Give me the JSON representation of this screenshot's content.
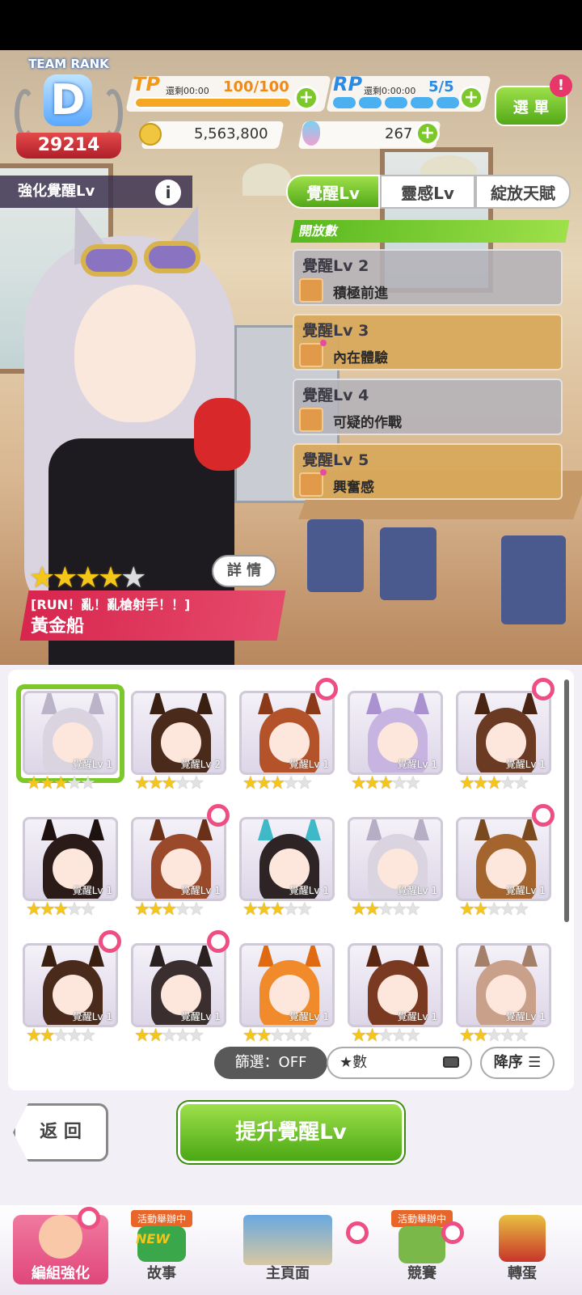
{
  "header": {
    "team_rank_label": "TEAM RANK",
    "rank_letter": "D",
    "rank_score": "29214",
    "tp": {
      "label": "TP",
      "remain": "還剩00:00",
      "value": "100/100",
      "fill": 1.0
    },
    "rp": {
      "label": "RP",
      "remain": "還剩0:00:00",
      "value": "5/5",
      "segments": 5
    },
    "money": "5,563,800",
    "carats": "267",
    "menu_label": "選 單",
    "menu_badge": "!"
  },
  "section": {
    "label": "強化覺醒Lv",
    "info": "i"
  },
  "tabs": [
    {
      "label": "覺醒Lv",
      "active": true
    },
    {
      "label": "靈感Lv",
      "active": false
    },
    {
      "label": "綻放天賦",
      "active": false
    }
  ],
  "open_label": "開放數",
  "levels": [
    {
      "title": "覺醒Lv 2",
      "skill": "積極前進",
      "style": "grey"
    },
    {
      "title": "覺醒Lv 3",
      "skill": "內在體驗",
      "style": "gold"
    },
    {
      "title": "覺醒Lv 4",
      "skill": "可疑的作戰",
      "style": "grey"
    },
    {
      "title": "覺醒Lv 5",
      "skill": "興奮感",
      "style": "gold"
    }
  ],
  "card": {
    "rarity": 4,
    "max_rarity": 5,
    "title": "[RUN！亂！亂槍射手！！]",
    "name": "黃金船",
    "detail_label": "詳 情"
  },
  "roster": [
    {
      "lv": "覺醒Lv 1",
      "stars": 3,
      "hair": "#d9d4e0",
      "ear": "#bbb3c8",
      "selected": true,
      "ring": false
    },
    {
      "lv": "覺醒Lv 2",
      "stars": 3,
      "hair": "#4a2a1a",
      "ear": "#3a2010",
      "selected": false,
      "ring": false
    },
    {
      "lv": "覺醒Lv 1",
      "stars": 3,
      "hair": "#b4532a",
      "ear": "#8a3a18",
      "selected": false,
      "ring": true
    },
    {
      "lv": "覺醒Lv 1",
      "stars": 3,
      "hair": "#c7b4e0",
      "ear": "#a992cf",
      "selected": false,
      "ring": false
    },
    {
      "lv": "覺醒Lv 1",
      "stars": 3,
      "hair": "#6a3a22",
      "ear": "#4a2412",
      "selected": false,
      "ring": true
    },
    {
      "lv": "覺醒Lv 1",
      "stars": 3,
      "hair": "#2a1a18",
      "ear": "#1e1210",
      "selected": false,
      "ring": false
    },
    {
      "lv": "覺醒Lv 1",
      "stars": 3,
      "hair": "#9a4a2a",
      "ear": "#6a3018",
      "selected": false,
      "ring": true
    },
    {
      "lv": "覺醒Lv 1",
      "stars": 3,
      "hair": "#2e2426",
      "ear": "#3fb8c8",
      "selected": false,
      "ring": false
    },
    {
      "lv": "覺醒Lv 1",
      "stars": 2,
      "hair": "#d9d4e0",
      "ear": "#b6aec4",
      "selected": false,
      "ring": false
    },
    {
      "lv": "覺醒Lv 1",
      "stars": 2,
      "hair": "#a4642e",
      "ear": "#7a4a1e",
      "selected": false,
      "ring": true
    },
    {
      "lv": "覺醒Lv 1",
      "stars": 2,
      "hair": "#4a2a1a",
      "ear": "#3a2010",
      "selected": false,
      "ring": true
    },
    {
      "lv": "覺醒Lv 1",
      "stars": 2,
      "hair": "#3a2e2e",
      "ear": "#2a2020",
      "selected": false,
      "ring": true
    },
    {
      "lv": "覺醒Lv 1",
      "stars": 2,
      "hair": "#f08a2a",
      "ear": "#e06a14",
      "selected": false,
      "ring": false
    },
    {
      "lv": "覺醒Lv 1",
      "stars": 2,
      "hair": "#7a3a22",
      "ear": "#5a2812",
      "selected": false,
      "ring": false
    },
    {
      "lv": "覺醒Lv 1",
      "stars": 2,
      "hair": "#c9a08a",
      "ear": "#a4806a",
      "selected": false,
      "ring": false
    }
  ],
  "filter_label": "篩選：OFF",
  "sort_label": "★數",
  "order_label": "降序",
  "back_label": "返 回",
  "upgrade_label": "提升覺醒Lv",
  "nav": [
    {
      "label": "編組強化",
      "active": true,
      "event": "",
      "icon": "team-icon"
    },
    {
      "label": "故事",
      "active": false,
      "event": "活動舉辦中",
      "icon": "story-book-icon"
    },
    {
      "label": "主頁面",
      "active": false,
      "event": "",
      "icon": "school-building-icon"
    },
    {
      "label": "競賽",
      "active": false,
      "event": "活動舉辦中",
      "icon": "race-icon"
    },
    {
      "label": "轉蛋",
      "active": false,
      "event": "",
      "icon": "gacha-icon"
    }
  ],
  "story_new": "NEW",
  "colors": {
    "accent_green": "#7cc82a",
    "accent_pink": "#e0467a",
    "star": "#f5c61a"
  }
}
